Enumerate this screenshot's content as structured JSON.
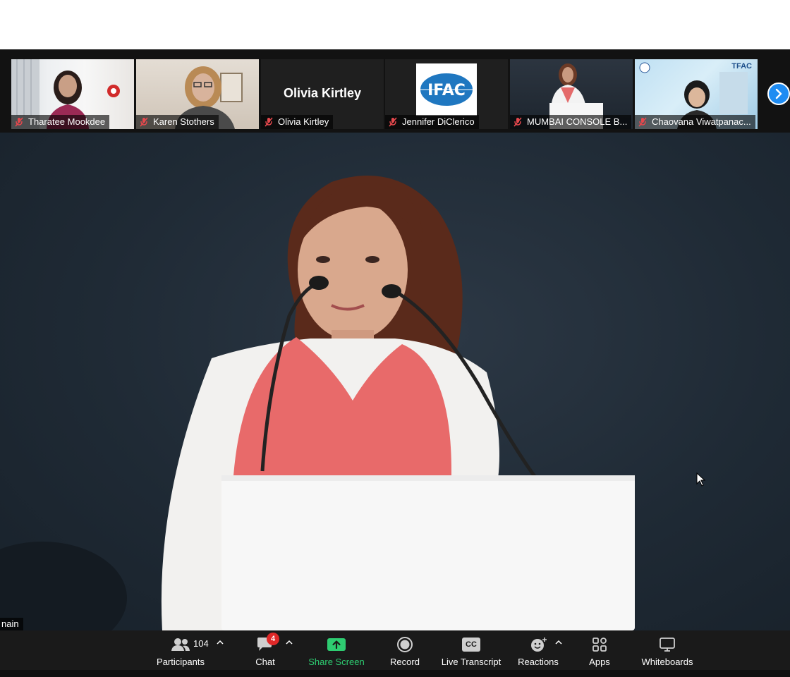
{
  "window": {
    "participants_strip": [
      {
        "name": "Tharatee Mookdee",
        "muted": true
      },
      {
        "name": "Karen Stothers",
        "muted": true
      },
      {
        "name": "Olivia Kirtley",
        "muted": true,
        "tile_text": "Olivia Kirtley"
      },
      {
        "name": "Jennifer DiClerico",
        "muted": true,
        "tile_text": "IFAC"
      },
      {
        "name": "MUMBAI CONSOLE B...",
        "muted": true
      },
      {
        "name": "Chaovana Viwatpanac...",
        "muted": true,
        "tile_text": "TFAC"
      }
    ],
    "next_page_icon": "chevron-right-icon"
  },
  "main_video": {
    "speaker_label": "nain"
  },
  "toolbar": {
    "participants_label": "Participants",
    "participants_count": "104",
    "chat_label": "Chat",
    "chat_badge": "4",
    "share_label": "Share Screen",
    "record_label": "Record",
    "transcript_label": "Live Transcript",
    "transcript_icon_text": "CC",
    "reactions_label": "Reactions",
    "apps_label": "Apps",
    "whiteboards_label": "Whiteboards"
  },
  "colors": {
    "share_accent": "#2ecc71",
    "badge_red": "#e02828",
    "next_button_blue": "#1f8cf2",
    "muted_icon_red": "#e5484d"
  }
}
